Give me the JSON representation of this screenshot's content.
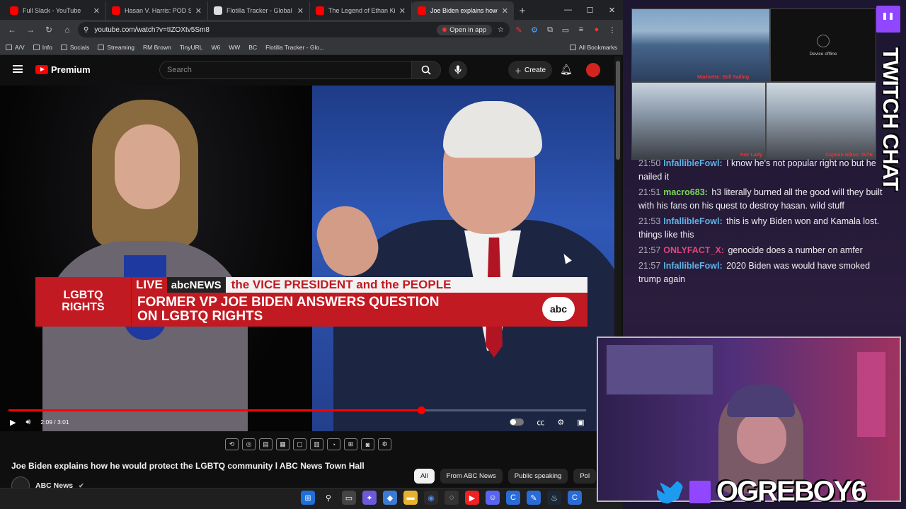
{
  "browser": {
    "tabs": [
      {
        "title": "Full Slack - YouTube",
        "color": "#ff0000",
        "active": false
      },
      {
        "title": "Hasan V. Harris: POD SAVE",
        "color": "#ff0000",
        "active": false
      },
      {
        "title": "Flotilla Tracker - Global Mo",
        "color": "#e0e0e0",
        "active": false
      },
      {
        "title": "The Legend of Ethan Ki",
        "color": "#ff0000",
        "active": false
      },
      {
        "title": "Joe Biden explains how",
        "color": "#ff0000",
        "active": true
      }
    ],
    "url": "youtube.com/watch?v=tIZOXtv5Sm8",
    "open_in_app": "Open in app",
    "bookmarks": [
      "A/V",
      "Info",
      "Socials",
      "Streaming",
      "RM Brown",
      "TinyURL",
      "W6",
      "WW",
      "BC",
      "Flotilla Tracker - Glo..."
    ],
    "all_bookmarks": "All Bookmarks"
  },
  "youtube": {
    "logo": "Premium",
    "search_placeholder": "Search",
    "create": "Create",
    "video": {
      "lower_third": {
        "topic": "LGBTQ\nRIGHTS",
        "live": "LIVE",
        "network": "abcNEWS",
        "show": "the VICE PRESIDENT and the PEOPLE",
        "headline": "FORMER VP JOE BIDEN ANSWERS QUESTION\nON LGBTQ RIGHTS",
        "logo": "abc"
      },
      "time": "2:09 / 3:01",
      "progress": 0.714
    },
    "title": "Joe Biden explains how he would protect the LGBTQ community l ABC News Town Hall",
    "channel": "ABC News",
    "chips": [
      {
        "label": "All",
        "selected": true
      },
      {
        "label": "From ABC News",
        "selected": false
      },
      {
        "label": "Public speaking",
        "selected": false
      },
      {
        "label": "Pol",
        "selected": false
      }
    ]
  },
  "overlay": {
    "cameras": {
      "cam1_label": "Marinette: Still Sailing",
      "cam2_status": "Device offline",
      "cam3_label": "Fair Lady",
      "cam4_label": "Captain Nikos: INTE"
    },
    "chat_title": "TWITCH CHAT",
    "chat": [
      {
        "time": "21:50",
        "user": "InfallibleFowl:",
        "color": "#5fb3e6",
        "text": "I know he's not popular right no but he nailed it"
      },
      {
        "time": "21:51",
        "user": "macro683:",
        "color": "#7ed957",
        "text": "h3 literally burned all the good will they built with his fans on his quest to destroy hasan. wild stuff"
      },
      {
        "time": "21:53",
        "user": "InfallibleFowl:",
        "color": "#5fb3e6",
        "text": "this is why Biden won and Kamala lost. things like this"
      },
      {
        "time": "21:57",
        "user": "ONLYFACT_X:",
        "color": "#e0457b",
        "text": "genocide does a number on amfer"
      },
      {
        "time": "21:57",
        "user": "InfallibleFowl:",
        "color": "#5fb3e6",
        "text": "2020 Biden was would have smoked trump again"
      }
    ],
    "handle": "OGREBOY6"
  },
  "colors": {
    "youtube_red": "#ff0000",
    "abc_red": "#c21a22",
    "twitch_purple": "#9146ff"
  }
}
